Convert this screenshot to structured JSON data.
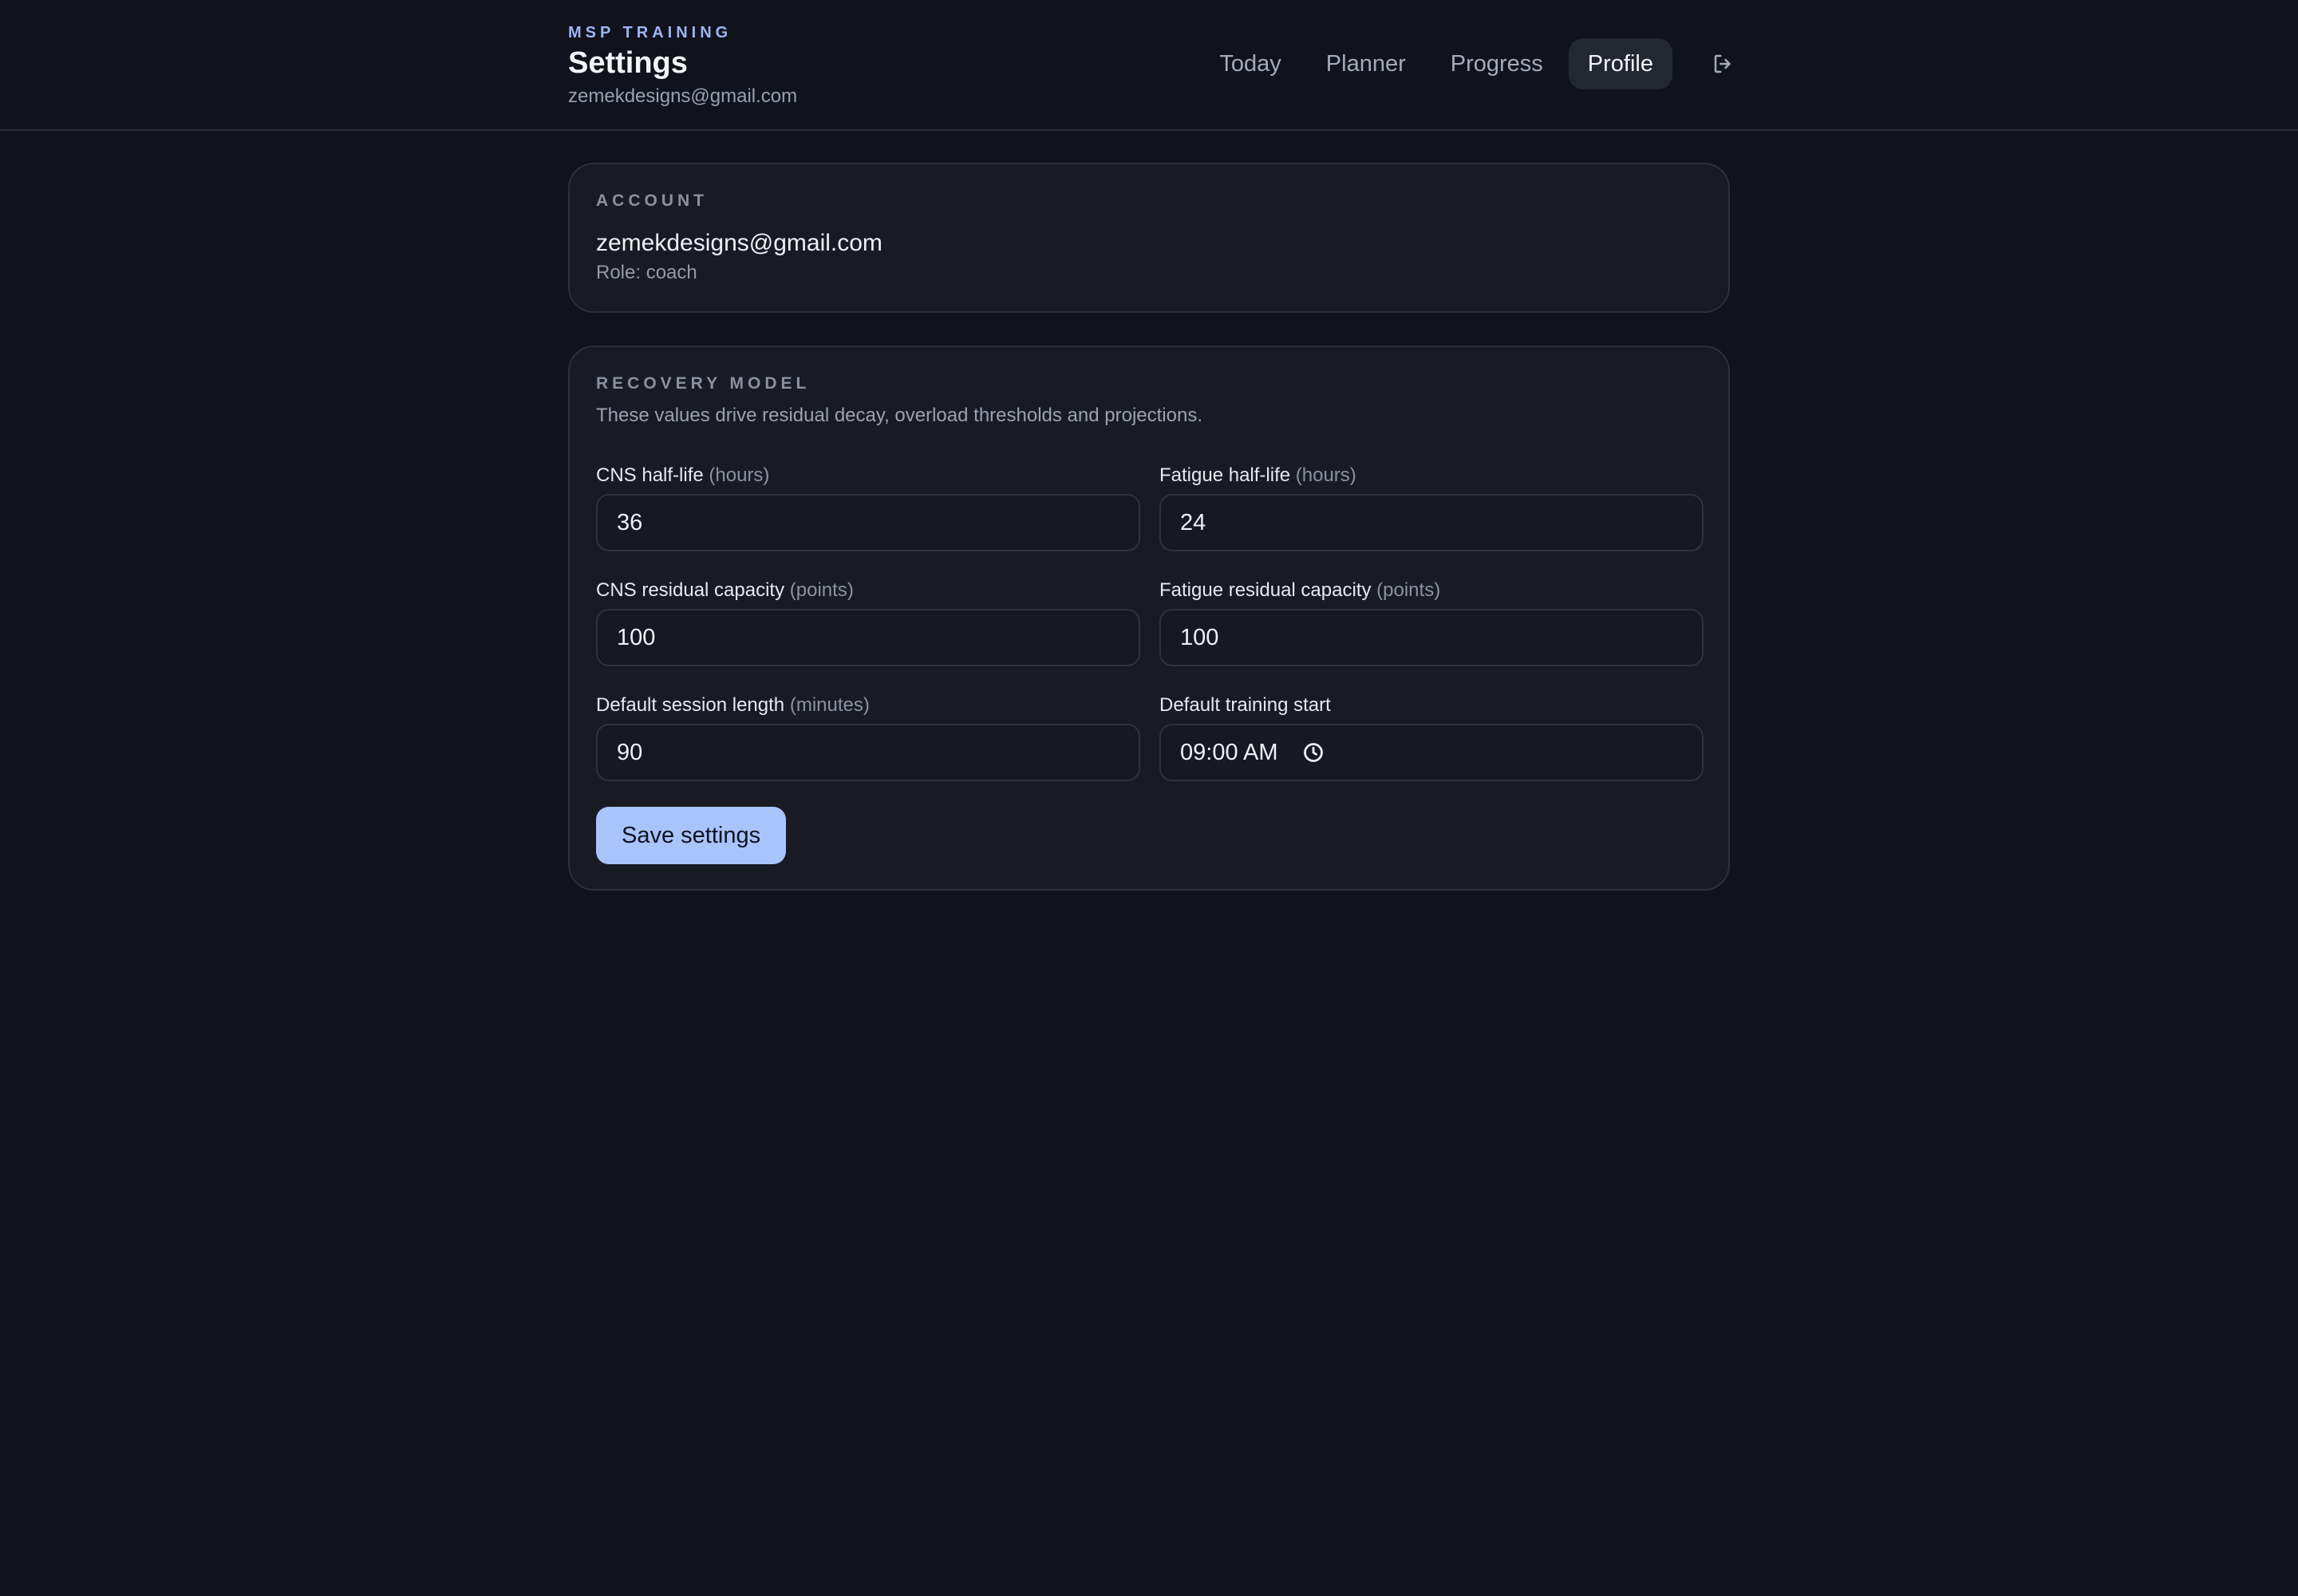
{
  "header": {
    "eyebrow": "MSP TRAINING",
    "title": "Settings",
    "email": "zemekdesigns@gmail.com"
  },
  "nav": {
    "tabs": [
      {
        "label": "Today",
        "active": false
      },
      {
        "label": "Planner",
        "active": false
      },
      {
        "label": "Progress",
        "active": false
      },
      {
        "label": "Profile",
        "active": true
      }
    ],
    "logout_icon": "logout-icon"
  },
  "account": {
    "section_label": "ACCOUNT",
    "email": "zemekdesigns@gmail.com",
    "role": "Role: coach"
  },
  "recovery": {
    "section_label": "RECOVERY MODEL",
    "description": "These values drive residual decay, overload thresholds and projections.",
    "fields": [
      {
        "label": "CNS half-life",
        "unit": "(hours)",
        "value": "36"
      },
      {
        "label": "Fatigue half-life",
        "unit": "(hours)",
        "value": "24"
      },
      {
        "label": "CNS residual capacity",
        "unit": "(points)",
        "value": "100"
      },
      {
        "label": "Fatigue residual capacity",
        "unit": "(points)",
        "value": "100"
      },
      {
        "label": "Default session length",
        "unit": "(minutes)",
        "value": "90"
      },
      {
        "label": "Default training start",
        "unit": "",
        "value": "09:00 AM",
        "icon": "clock-icon"
      }
    ],
    "save_label": "Save settings"
  },
  "colors": {
    "background": "#10131c",
    "card": "#181b24",
    "accent": "#a9c3fb",
    "eyebrow": "#9fb4f5"
  }
}
